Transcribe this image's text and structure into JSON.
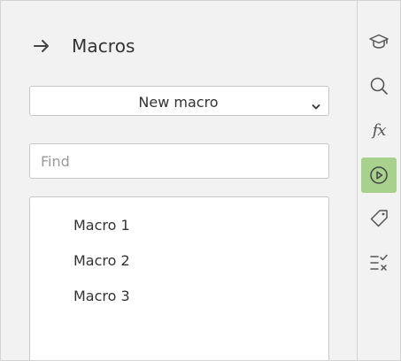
{
  "panel": {
    "title": "Macros",
    "back_icon": "arrow-right-icon"
  },
  "new_macro": {
    "selected": "New macro"
  },
  "find": {
    "placeholder": "Find",
    "value": ""
  },
  "macros": [
    {
      "label": "Macro 1"
    },
    {
      "label": "Macro 2"
    },
    {
      "label": "Macro 3"
    }
  ],
  "rail": {
    "buttons": [
      {
        "icon": "graduation-cap-icon",
        "active": false
      },
      {
        "icon": "search-icon",
        "active": false
      },
      {
        "icon": "fx-icon",
        "text": "fx",
        "active": false
      },
      {
        "icon": "play-circle-icon",
        "active": true
      },
      {
        "icon": "tag-icon",
        "active": false
      },
      {
        "icon": "check-x-list-icon",
        "active": false
      }
    ]
  },
  "colors": {
    "panel_bg": "#f2f2f2",
    "active_bg": "#a9d18e",
    "border": "#c8c8c8",
    "text": "#333333",
    "placeholder": "#9a9a9a"
  }
}
